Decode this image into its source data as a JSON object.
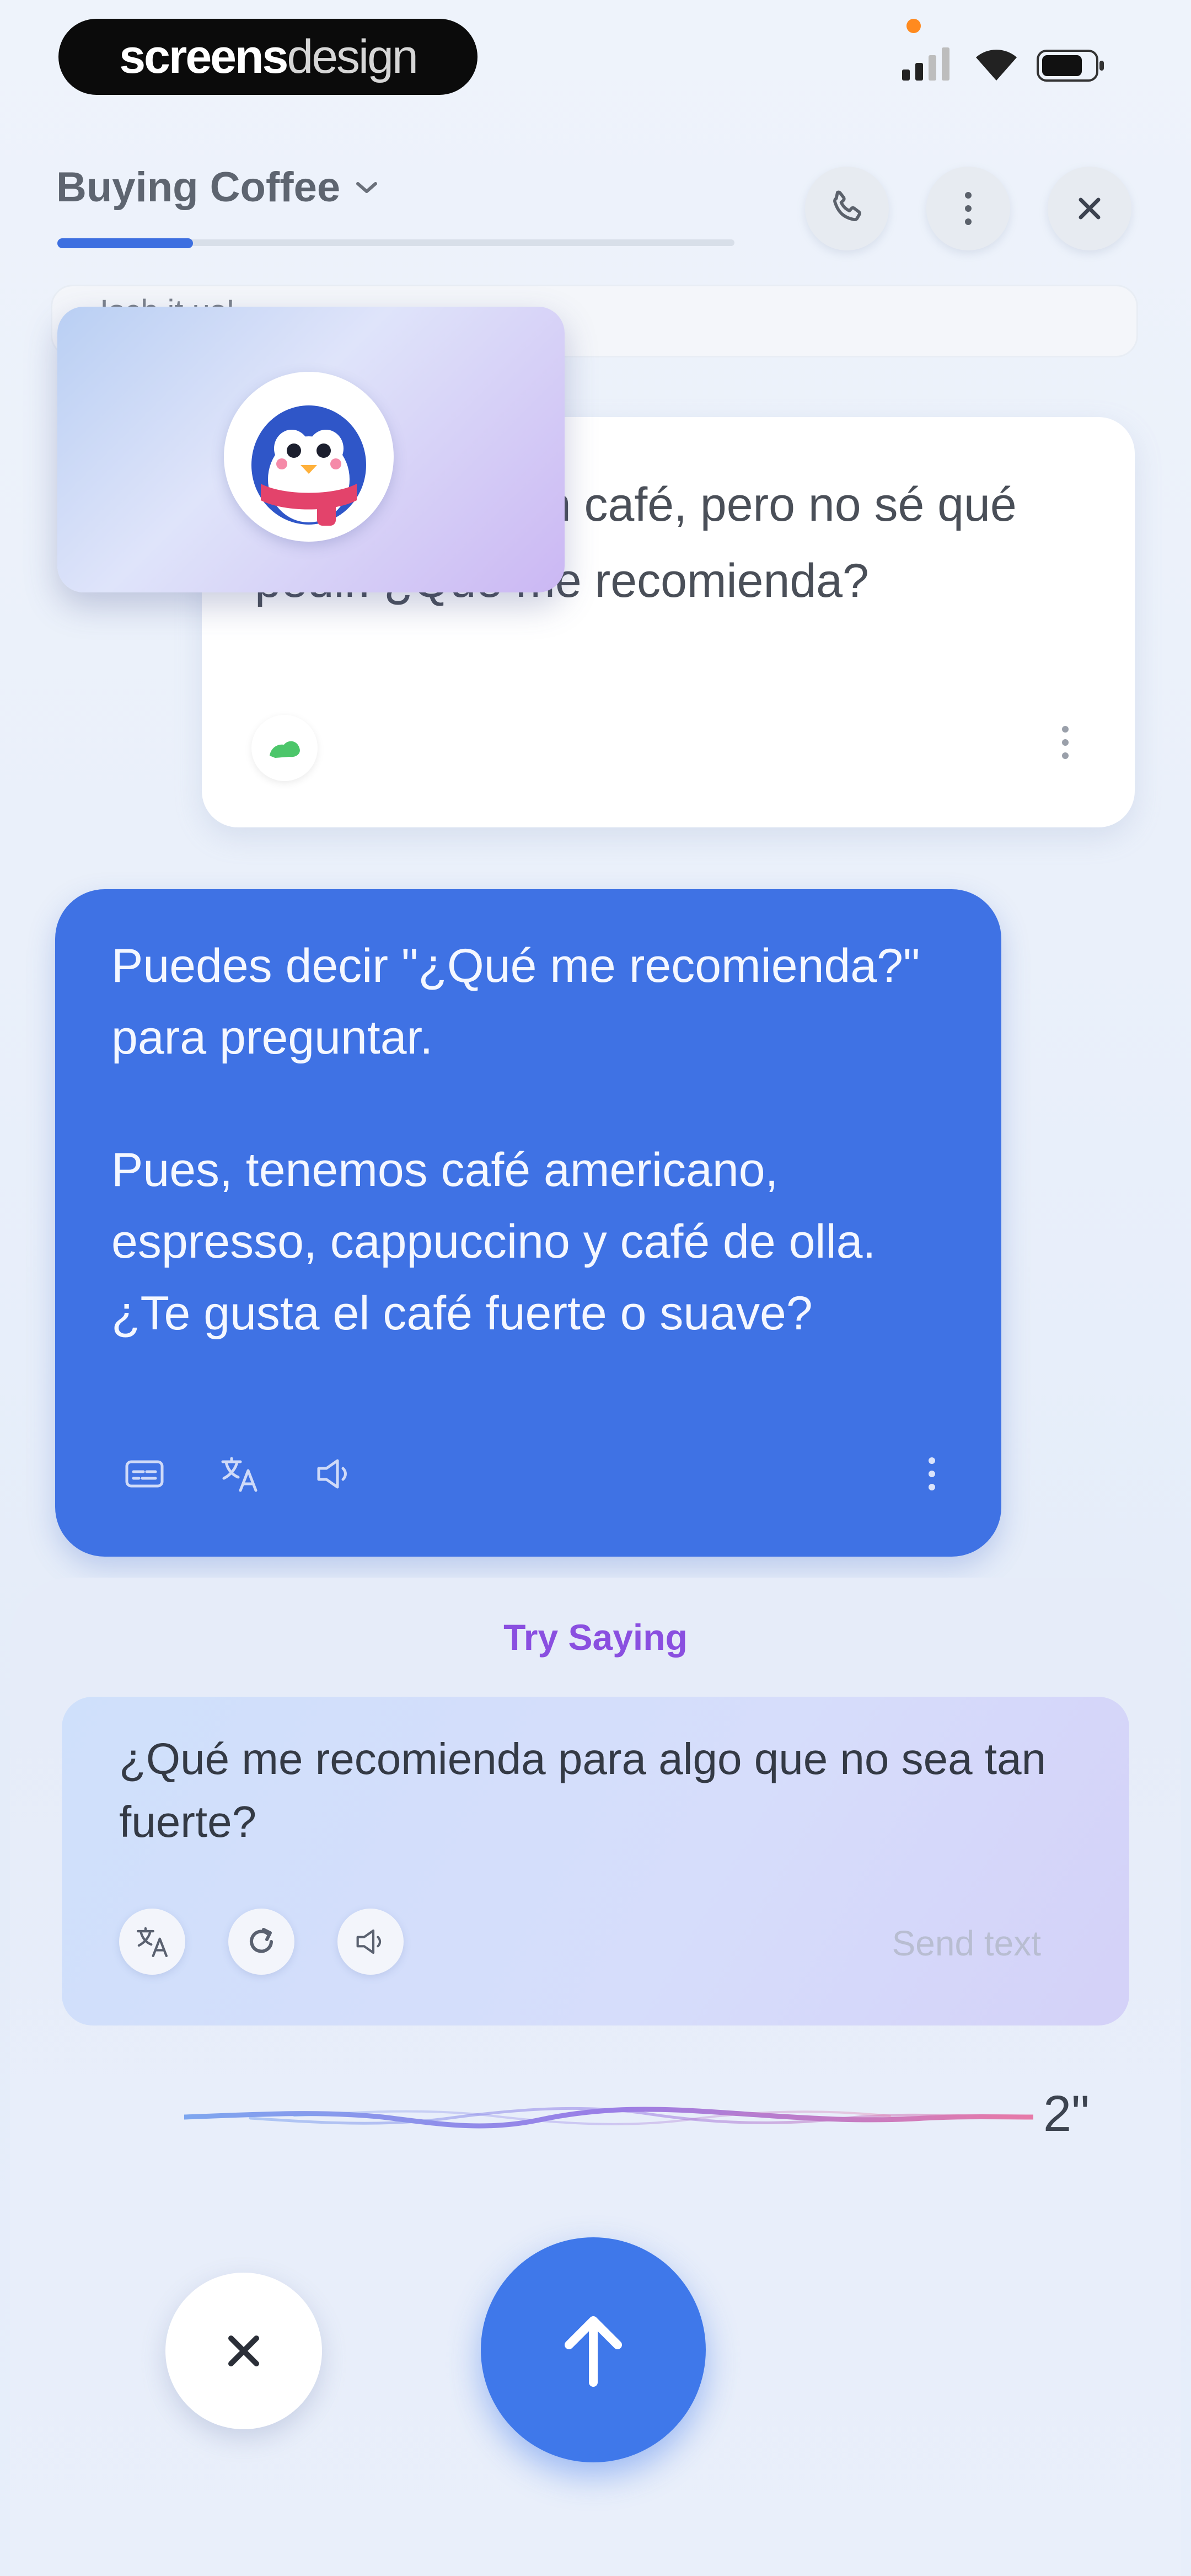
{
  "status_bar": {
    "brand_bold": "screens",
    "brand_light": "design"
  },
  "header": {
    "topic": "Buying Coffee",
    "lesson_progress": 0.2
  },
  "chat": {
    "faded_message_snippet": "Isch it us!",
    "user_message": "Me gustaría un café, pero no sé qué pedir. ¿Qué me recomienda?",
    "ai_message_p1": "Puedes decir \"¿Qué me recomienda?\" para preguntar.",
    "ai_message_p2": "Pues, tenemos café americano, espresso, cappuccino y café de olla. ¿Te gusta el café fuerte o suave?"
  },
  "suggestion_panel": {
    "title": "Try Saying",
    "suggestion_text": "¿Qué me recomienda para algo que no sea tan fuerte?",
    "send_text_label": "Send text"
  },
  "recording": {
    "timer": "2\""
  },
  "colors": {
    "accent_blue": "#3f72e4",
    "try_saying_purple": "#8a4fe0",
    "status_dot_orange": "#ff8a1f",
    "quality_green": "#4cc66a"
  },
  "icons": {
    "call": "phone-icon",
    "more": "more-vertical-icon",
    "close": "close-icon",
    "avatar": "penguin-avatar",
    "send": "arrow-up-icon"
  }
}
